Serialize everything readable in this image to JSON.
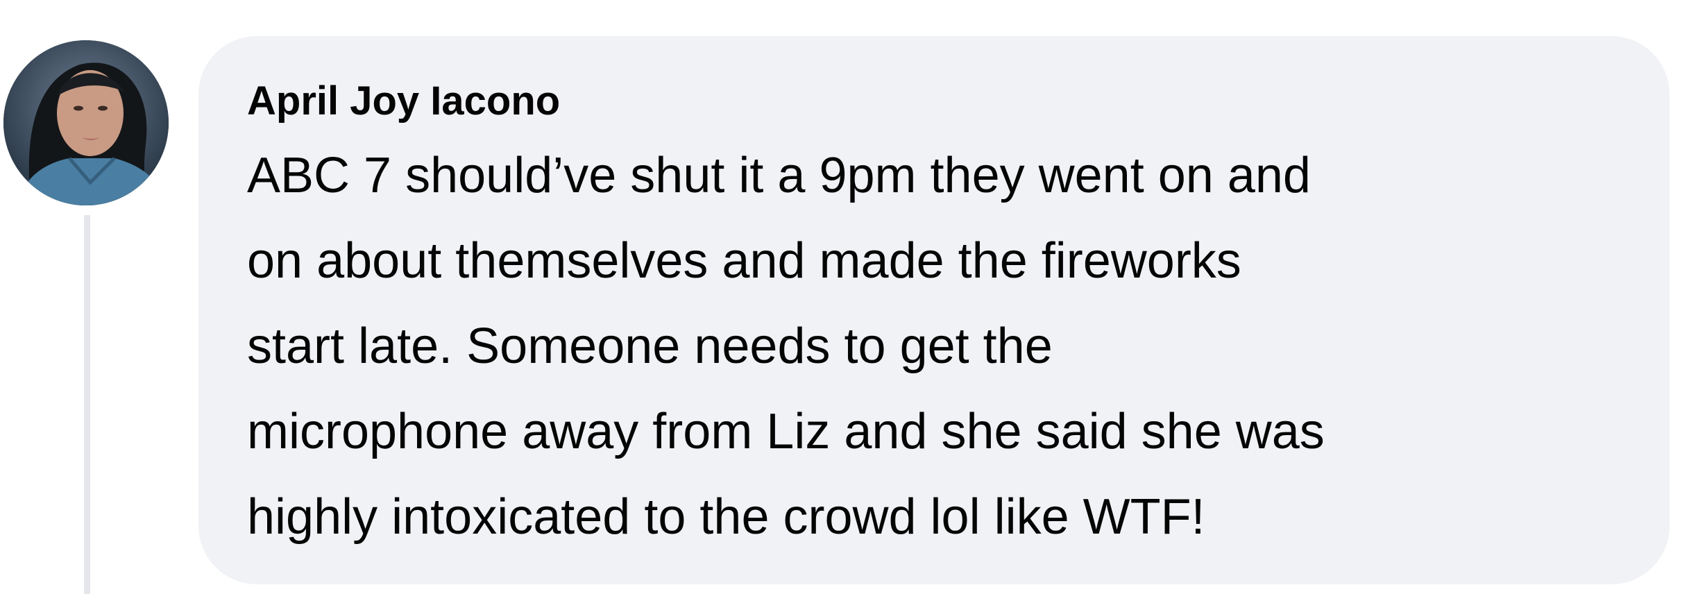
{
  "comment": {
    "author_name": "April Joy Iacono",
    "text": "ABC 7 should’ve shut it a 9pm they went on and\non about themselves and made the fireworks\nstart late. Someone needs to get the\nmicrophone away from Liz and she said she was\nhighly intoxicated to the crowd lol like WTF!",
    "avatar_icon": "profile-photo"
  },
  "colors": {
    "bubble_background": "#f0f2f5",
    "text": "#050505",
    "thread_line": "#e4e6eb"
  }
}
